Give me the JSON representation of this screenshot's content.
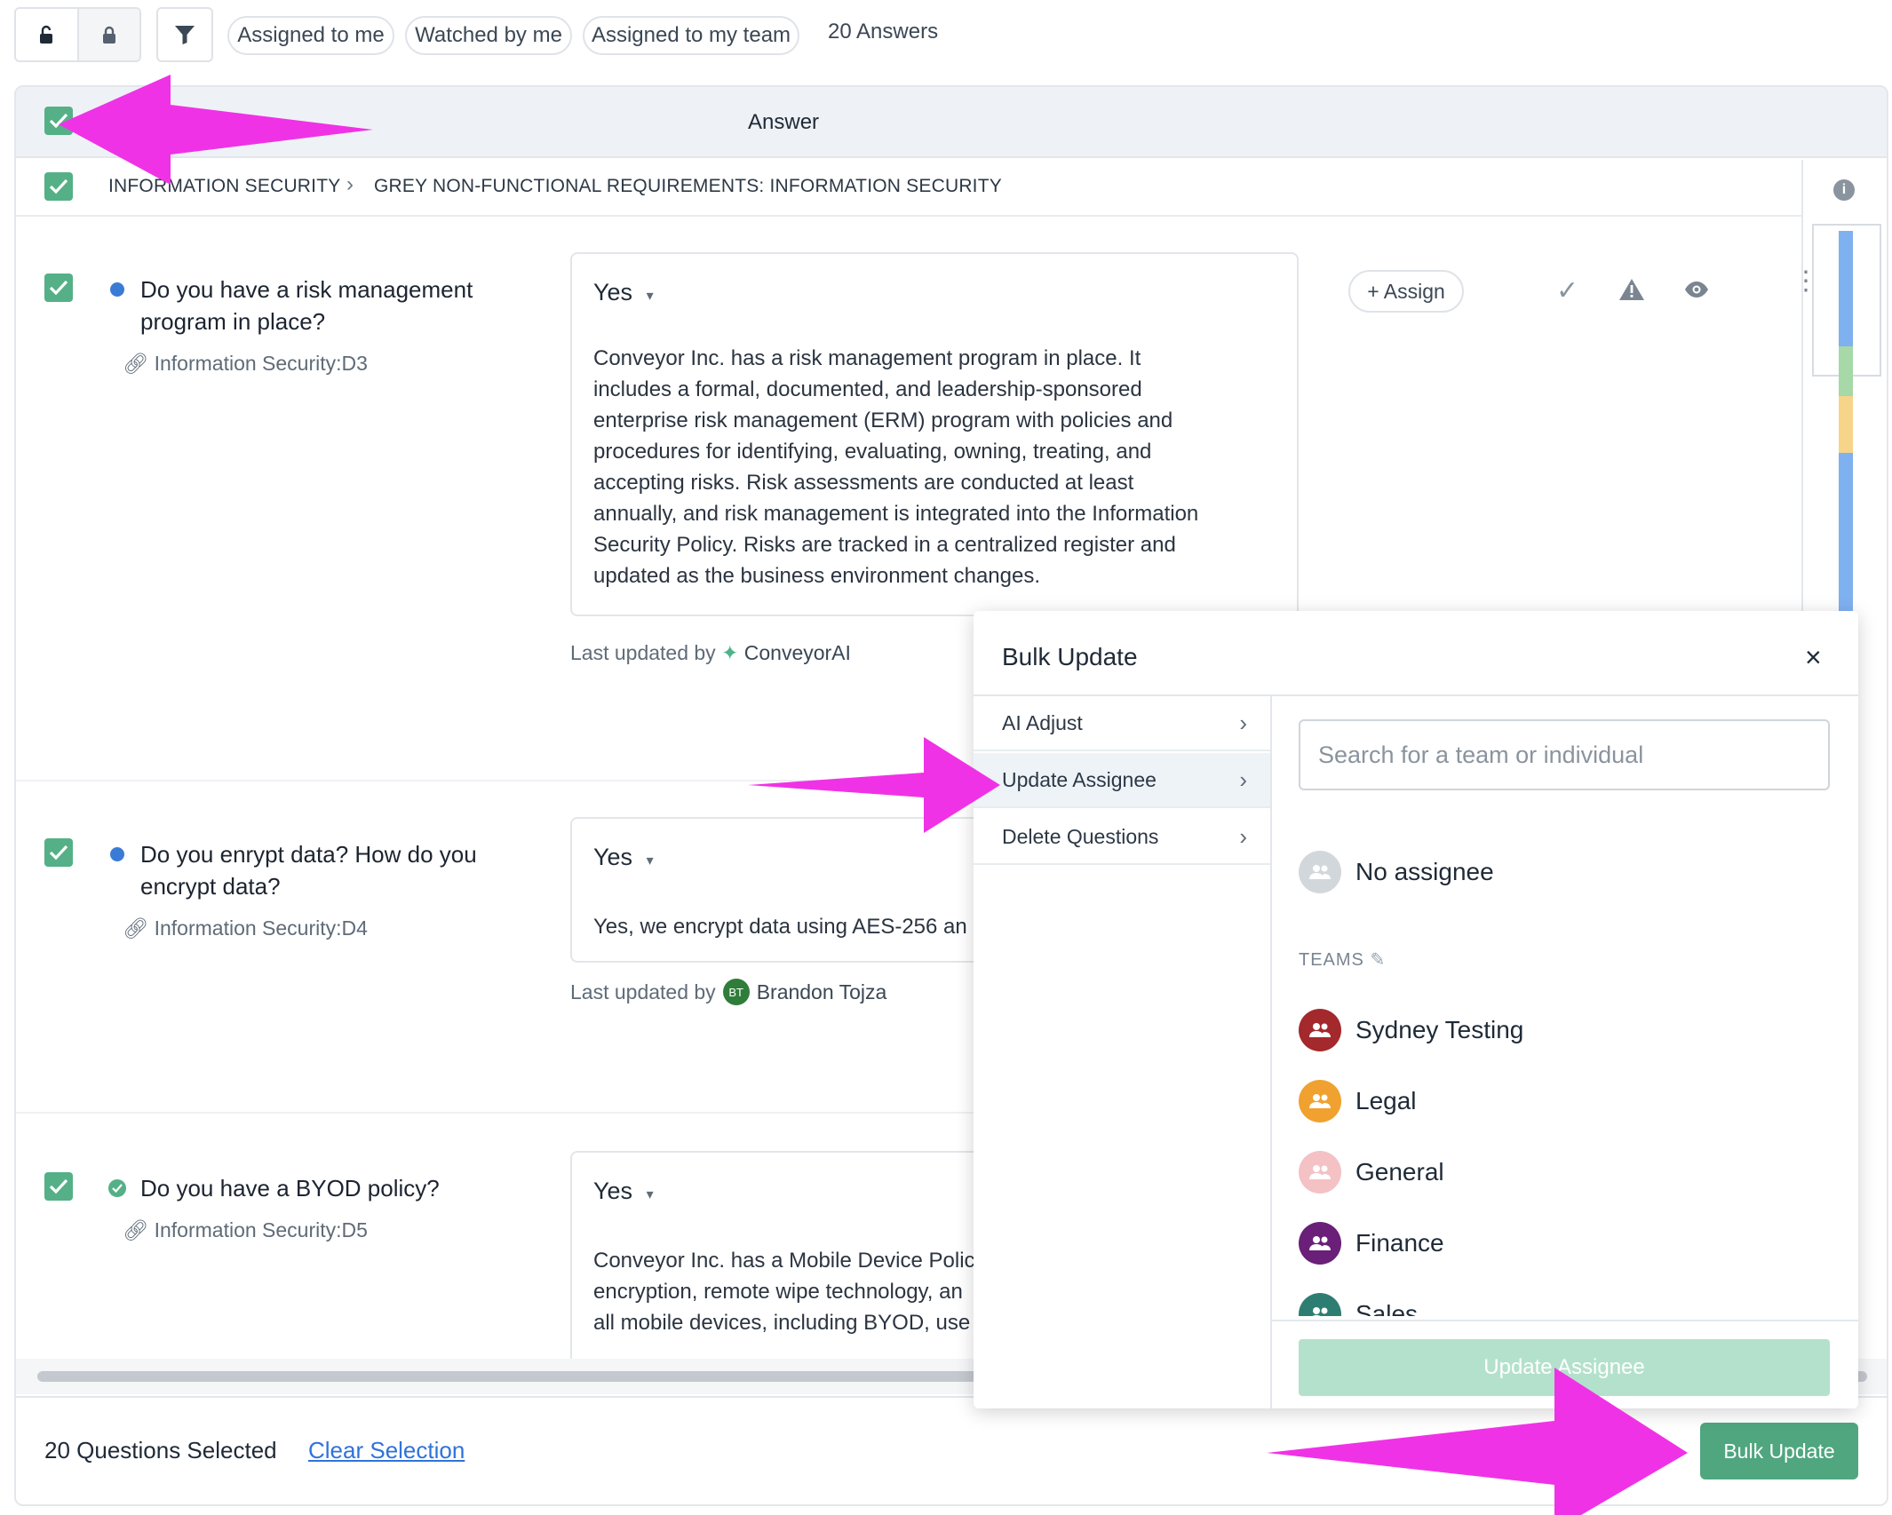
{
  "toolbar": {
    "filters": [
      "Assigned to me",
      "Watched by me",
      "Assigned to my team"
    ],
    "answers_count": "20 Answers"
  },
  "table": {
    "header": "Answer",
    "breadcrumb": [
      "INFORMATION SECURITY",
      "GREY NON-FUNCTIONAL REQUIREMENTS: INFORMATION SECURITY"
    ]
  },
  "rows": [
    {
      "question": [
        "Do you have a risk management",
        "program in place?"
      ],
      "ref": "Information Security:D3",
      "answer": "Yes",
      "text": [
        "Conveyor Inc. has a risk management program in place. It",
        "includes a formal, documented, and leadership-sponsored",
        "enterprise risk management (ERM) program with policies and",
        "procedures for identifying, evaluating, owning, treating, and",
        "accepting risks. Risk assessments are conducted at least",
        "annually, and risk management is integrated into the Information",
        "Security Policy. Risks are tracked in a centralized register and",
        "updated as the business environment changes."
      ],
      "updated_label": "Last updated by",
      "updated_by": "ConveyorAI",
      "assign_label": "+ Assign"
    },
    {
      "question": [
        "Do you enrypt data? How do you",
        "encrypt data?"
      ],
      "ref": "Information Security:D4",
      "answer": "Yes",
      "text": [
        "Yes, we encrypt data using AES-256 an"
      ],
      "updated_label": "Last updated by",
      "updated_initials": "BT",
      "updated_by": "Brandon Tojza"
    },
    {
      "question": [
        "Do you have a BYOD policy?"
      ],
      "ref": "Information Security:D5",
      "answer": "Yes",
      "text": [
        "Conveyor Inc. has a Mobile Device Polic",
        "encryption, remote wipe technology, an",
        "all mobile devices, including BYOD, use"
      ]
    }
  ],
  "footer": {
    "selected": "20 Questions Selected",
    "clear": "Clear Selection",
    "bulk_update": "Bulk Update"
  },
  "modal": {
    "title": "Bulk Update",
    "close": "×",
    "menu": [
      "AI Adjust",
      "Update Assignee",
      "Delete Questions"
    ],
    "search_placeholder": "Search for a team or individual",
    "no_assignee": "No assignee",
    "teams_label": "TEAMS",
    "teams": [
      {
        "name": "Sydney Testing",
        "color": "#a3292c"
      },
      {
        "name": "Legal",
        "color": "#f0a12f"
      },
      {
        "name": "General",
        "color": "#f4c1c5"
      },
      {
        "name": "Finance",
        "color": "#6a1f78"
      },
      {
        "name": "Sales",
        "color": "#2e7d73"
      }
    ],
    "update_button": "Update Assignee"
  },
  "colors": {
    "accent_green": "#55b087",
    "annotation_magenta": "#f032e6"
  }
}
